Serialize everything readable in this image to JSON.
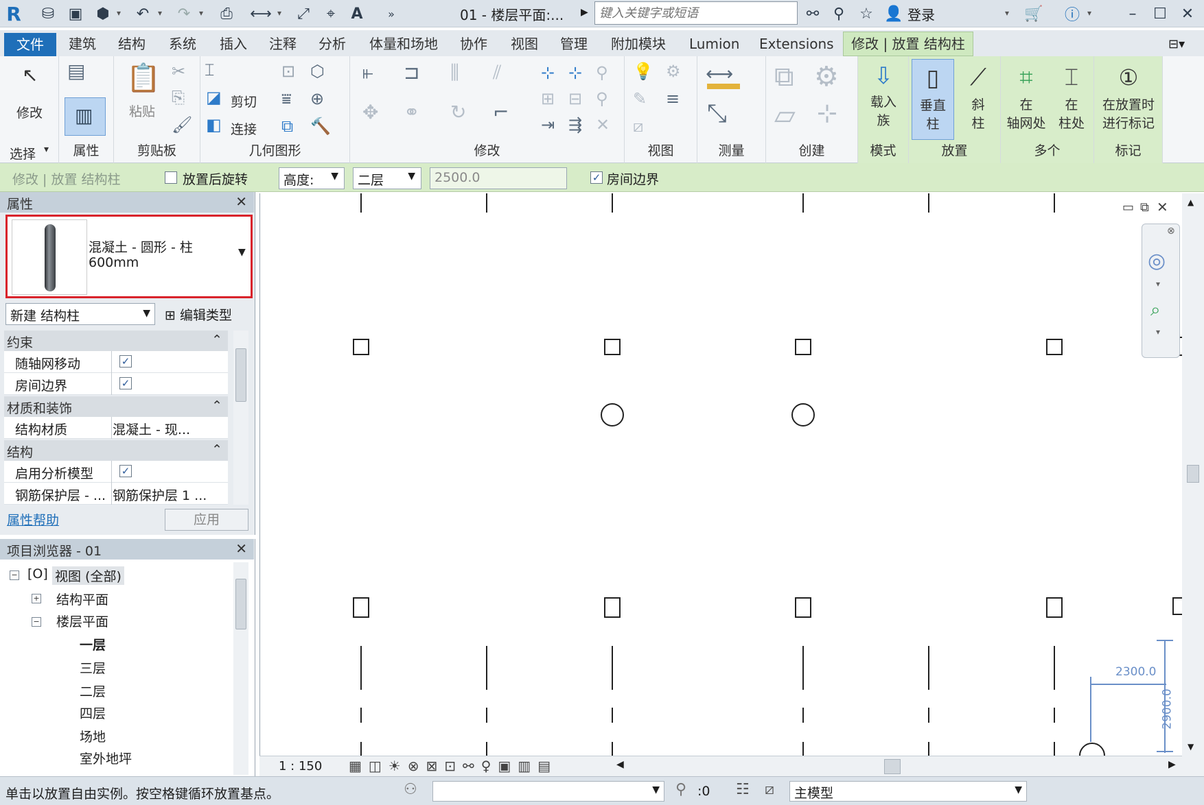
{
  "titlebar": {
    "doc_title": "01 - 楼层平面:...",
    "search_placeholder": "键入关键字或短语",
    "login_label": "登录"
  },
  "menu": {
    "tabs": [
      "文件",
      "建筑",
      "结构",
      "系统",
      "插入",
      "注释",
      "分析",
      "体量和场地",
      "协作",
      "视图",
      "管理",
      "附加模块",
      "Lumion",
      "Extensions",
      "修改 | 放置 结构柱"
    ]
  },
  "ribbon": {
    "select_group": {
      "modify_label": "修改",
      "label": "选择",
      "caret": "▾"
    },
    "properties_group": {
      "label": "属性"
    },
    "clipboard_group": {
      "paste_label": "粘贴",
      "label": "剪贴板"
    },
    "geometry_group": {
      "cut_label": "剪切",
      "join_label": "连接",
      "label": "几何图形"
    },
    "modify_group": {
      "label": "修改"
    },
    "view_group": {
      "label": "视图"
    },
    "measure_group": {
      "label": "测量"
    },
    "create_group": {
      "label": "创建"
    },
    "mode_group": {
      "load_family_line1": "载入",
      "load_family_line2": "族",
      "label": "模式"
    },
    "place_group": {
      "vertical_line1": "垂直",
      "vertical_line2": "柱",
      "slanted_line1": "斜",
      "slanted_line2": "柱",
      "label": "放置"
    },
    "multiple_group": {
      "at_grids_line1": "在",
      "at_grids_line2": "轴网处",
      "at_columns_line1": "在",
      "at_columns_line2": "柱处",
      "label": "多个"
    },
    "tag_group": {
      "tag_line1": "在放置时",
      "tag_line2": "进行标记",
      "label": "标记"
    }
  },
  "options_bar": {
    "context_label": "修改 | 放置 结构柱",
    "rotate_after_label": "放置后旋转",
    "rotate_after_checked": false,
    "height_label": "高度:",
    "level_value": "二层",
    "height_value": "2500.0",
    "room_bounding_label": "房间边界",
    "room_bounding_checked": true
  },
  "properties": {
    "title": "属性",
    "type_name_line1": "混凝土 - 圆形 - 柱",
    "type_name_line2": "600mm",
    "instance_filter": "新建 结构柱",
    "edit_type_label": "编辑类型",
    "groups": [
      {
        "name": "约束",
        "rows": [
          {
            "key": "随轴网移动",
            "checked": true
          },
          {
            "key": "房间边界",
            "checked": true
          }
        ]
      },
      {
        "name": "材质和装饰",
        "rows": [
          {
            "key": "结构材质",
            "value": "混凝土 - 现..."
          }
        ]
      },
      {
        "name": "结构",
        "rows": [
          {
            "key": "启用分析模型",
            "checked": true
          },
          {
            "key": "钢筋保护层 - ...",
            "value": "钢筋保护层 1 ..."
          }
        ]
      }
    ],
    "help_link": "属性帮助",
    "apply_label": "应用"
  },
  "browser": {
    "title": "项目浏览器 - 01",
    "root": "视图 (全部)",
    "structural_plans": "结构平面",
    "floor_plans": "楼层平面",
    "levels": [
      "一层",
      "三层",
      "二层",
      "四层",
      "场地",
      "室外地坪"
    ]
  },
  "canvas": {
    "dim_horizontal": "2300.0",
    "dim_vertical": "2900.0"
  },
  "viewbar": {
    "scale": "1 : 150"
  },
  "statusbar": {
    "hint": "单击以放置自由实例。按空格键循环放置基点。",
    "selection_count": ":0",
    "model_label": "主模型"
  },
  "colors": {
    "accent_blue": "#1f6fb9",
    "context_green": "#d7ecc8",
    "highlight_red": "#d9232b",
    "dimension_blue": "#6a8fc8"
  }
}
